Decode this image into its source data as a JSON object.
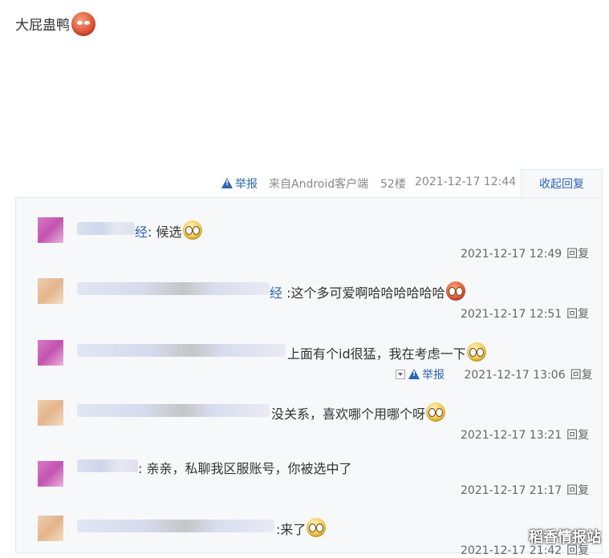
{
  "post": {
    "text": "大屁蛊鸭"
  },
  "meta": {
    "report_label": "举报",
    "source": "来自Android客户端",
    "floor": "52楼",
    "timestamp": "2021-12-17 12:44",
    "collapse_label": "收起回复"
  },
  "replies": [
    {
      "name_tail": "经",
      "message": "候选",
      "time": "2021-12-17 12:49",
      "reply_label": "回复"
    },
    {
      "name_tail": "经",
      "message": "这个多可爱啊哈哈哈哈哈哈",
      "time": "2021-12-17 12:51",
      "reply_label": "回复"
    },
    {
      "message": "上面有个id很猛，我在考虑一下",
      "report_label": "举报",
      "time": "2021-12-17 13:06",
      "reply_label": "回复"
    },
    {
      "message": "没关系，喜欢哪个用哪个呀",
      "time": "2021-12-17 13:21",
      "reply_label": "回复"
    },
    {
      "message": "亲亲，私聊我区服账号，你被选中了",
      "time": "2021-12-17 21:17",
      "reply_label": "回复"
    },
    {
      "message": "来了",
      "time": "2021-12-17 21:42",
      "reply_label": "回复"
    }
  ],
  "watermark": "稻香情报站"
}
